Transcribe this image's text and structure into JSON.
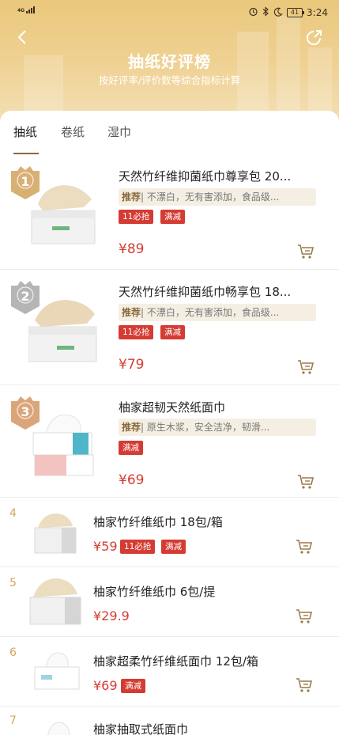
{
  "status_bar": {
    "network": "4G",
    "time": "3:24",
    "battery": "41"
  },
  "header": {
    "title": "抽纸好评榜",
    "subtitle": "按好评率/评价数等综合指标计算"
  },
  "tabs": [
    {
      "label": "抽纸"
    },
    {
      "label": "卷纸"
    },
    {
      "label": "湿巾"
    }
  ],
  "items": [
    {
      "rank": "1",
      "title": "天然竹纤维抑菌纸巾尊享包 20...",
      "rec_label": "推荐",
      "rec_text": "| 不漂白，无有害添加，食品级...",
      "tags": [
        "11必抢",
        "满减"
      ],
      "price": "¥89"
    },
    {
      "rank": "2",
      "title": "天然竹纤维抑菌纸巾畅享包 18...",
      "rec_label": "推荐",
      "rec_text": "| 不漂白，无有害添加，食品级...",
      "tags": [
        "11必抢",
        "满减"
      ],
      "price": "¥79"
    },
    {
      "rank": "3",
      "title": "柚家超韧天然纸面巾",
      "rec_label": "推荐",
      "rec_text": "| 原生木浆，安全洁净，韧滑...",
      "tags": [
        "满减"
      ],
      "price": "¥69"
    },
    {
      "rank": "4",
      "title": "柚家竹纤维纸巾 18包/箱",
      "tags": [
        "11必抢",
        "满减"
      ],
      "price": "¥59"
    },
    {
      "rank": "5",
      "title": "柚家竹纤维纸巾 6包/提",
      "tags": [],
      "price": "¥29.9"
    },
    {
      "rank": "6",
      "title": "柚家超柔竹纤维纸面巾 12包/箱",
      "tags": [
        "满减"
      ],
      "price": "¥69"
    },
    {
      "rank": "7",
      "title": "柚家抽取式纸面巾"
    }
  ],
  "colors": {
    "accent": "#d43c33",
    "gold": "#d1a75f",
    "header": "#eac87c"
  }
}
